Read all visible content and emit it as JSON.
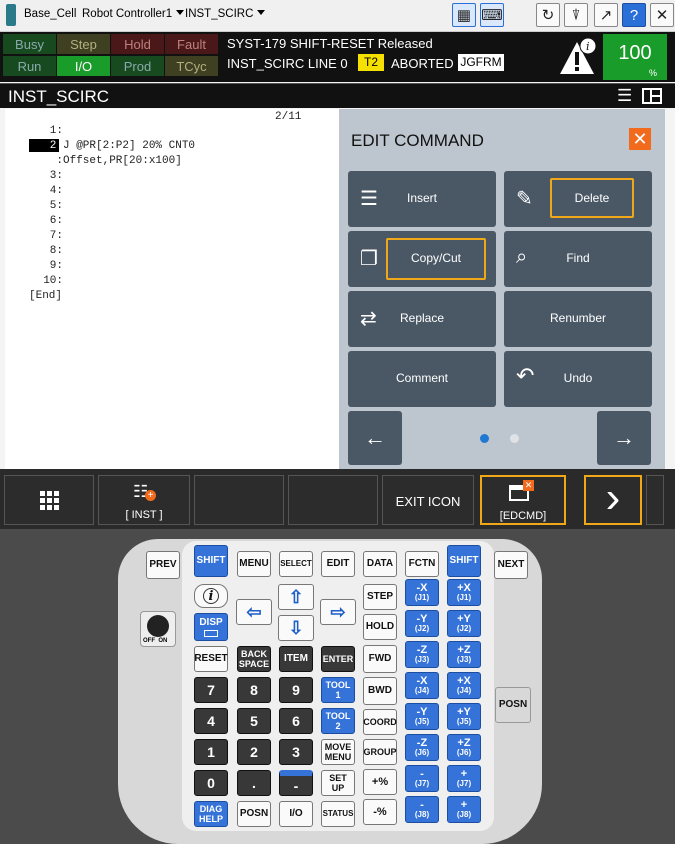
{
  "topbar": {
    "cell": "Base_Cell",
    "controller": "Robot Controller1",
    "program": "INST_SCIRC"
  },
  "status": {
    "busy": "Busy",
    "step": "Step",
    "hold": "Hold",
    "fault": "Fault",
    "run": "Run",
    "io": "I/O",
    "prod": "Prod",
    "tcyc": "TCyc",
    "message1": "SYST-179 SHIFT-RESET Released",
    "message2": "INST_SCIRC LINE 0",
    "tool_badge": "T2",
    "state": "ABORTED",
    "frame": "JGFRM",
    "override": "100",
    "override_unit": "%",
    "colors": {
      "green": "#1a8c2a",
      "dim": "#555555",
      "yellow": "#f5e000",
      "highlight": "#f0a818"
    }
  },
  "screen": {
    "title": "INST_SCIRC",
    "page": "2/11",
    "lines": [
      {
        "num": "1:",
        "text": ""
      },
      {
        "num": "2:",
        "text": "J @PR[2:P2] 20% CNT0"
      },
      {
        "num": ":",
        "text": "Offset,PR[20:x100]"
      },
      {
        "num": "3:",
        "text": ""
      },
      {
        "num": "4:",
        "text": ""
      },
      {
        "num": "5:",
        "text": ""
      },
      {
        "num": "6:",
        "text": ""
      },
      {
        "num": "7:",
        "text": ""
      },
      {
        "num": "8:",
        "text": ""
      },
      {
        "num": "9:",
        "text": ""
      },
      {
        "num": "10:",
        "text": ""
      },
      {
        "num": "",
        "text": "[End]"
      }
    ]
  },
  "edit_panel": {
    "title": "EDIT COMMAND",
    "buttons": {
      "insert": "Insert",
      "delete": "Delete",
      "copy_cut": "Copy/Cut",
      "find": "Find",
      "replace": "Replace",
      "renumber": "Renumber",
      "comment": "Comment",
      "undo": "Undo"
    },
    "nav": {
      "prev": "←",
      "next": "→"
    }
  },
  "fkeys": {
    "inst": "[ INST ]",
    "exit_icon": "EXIT ICON",
    "edcmd": "[EDCMD]",
    "more": "›"
  },
  "pendant": {
    "prev": "PREV",
    "shift": "SHIFT",
    "menu": "MENU",
    "select": "SELECT",
    "edit": "EDIT",
    "data": "DATA",
    "fctn": "FCTN",
    "next": "NEXT",
    "info": "i",
    "disp": "DISP",
    "step": "STEP",
    "hold": "HOLD",
    "fwd": "FWD",
    "bwd": "BWD",
    "coord": "COORD",
    "group": "GROUP",
    "reset": "RESET",
    "backspace1": "BACK",
    "backspace2": "SPACE",
    "item": "ITEM",
    "enter": "ENTER",
    "tool1a": "TOOL",
    "tool1b": "1",
    "tool2a": "TOOL",
    "tool2b": "2",
    "movemenu1": "MOVE",
    "movemenu2": "MENU",
    "setup1": "SET",
    "setup2": "UP",
    "diag1": "DIAG",
    "diag2": "HELP",
    "posn": "POSN",
    "io": "I/O",
    "status": "STATUS",
    "d7": "7",
    "d8": "8",
    "d9": "9",
    "d4": "4",
    "d5": "5",
    "d6": "6",
    "d1": "1",
    "d2": "2",
    "d3": "3",
    "d0": "0",
    "dot": ".",
    "minus": "-",
    "plus_pct": "+%",
    "minus_pct": "-%",
    "off_on": "OFF  ON",
    "jog": [
      [
        "-X",
        "(J1)",
        "+X",
        "(J1)"
      ],
      [
        "-Y",
        "(J2)",
        "+Y",
        "(J2)"
      ],
      [
        "-Z",
        "(J3)",
        "+Z",
        "(J3)"
      ],
      [
        "-X",
        "(J4)",
        "+X",
        "(J4)"
      ],
      [
        "-Y",
        "(J5)",
        "+Y",
        "(J5)"
      ],
      [
        "-Z",
        "(J6)",
        "+Z",
        "(J6)"
      ],
      [
        "-",
        "(J7)",
        "+",
        "(J7)"
      ],
      [
        "-",
        "(J8)",
        "+",
        "(J8)"
      ]
    ],
    "posn_side": "POSN"
  }
}
